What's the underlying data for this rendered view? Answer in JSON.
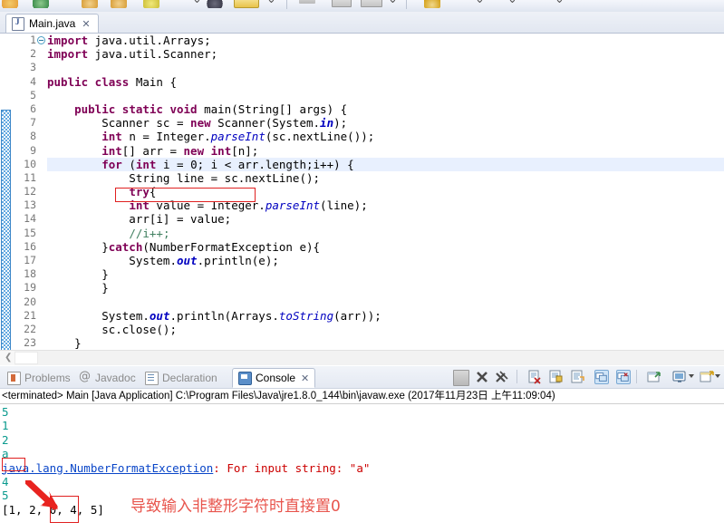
{
  "toolbar": {
    "items": [
      {
        "name": "new-wizard",
        "color": "#e8a33d"
      },
      {
        "name": "save",
        "color": "#4b8f4b"
      },
      {
        "name": "open-folder",
        "color": "#e0b050"
      },
      {
        "name": "open-type",
        "color": "#e0b050"
      },
      {
        "name": "run",
        "color": "#d9d24a"
      },
      {
        "name": "debug",
        "color": "#6a6a6a"
      },
      {
        "name": "run-last",
        "color": "#d9d24a"
      },
      {
        "name": "external-tools",
        "color": "#e8c24a"
      },
      {
        "name": "new-java-class",
        "color": "#8a8a8a"
      },
      {
        "name": "search",
        "color": "#8a8a8a"
      },
      {
        "name": "next-annotation",
        "color": "#8a8a8a"
      },
      {
        "name": "previous-annotation",
        "color": "#8a8a8a"
      },
      {
        "name": "last-edit-location",
        "color": "#d4a017"
      },
      {
        "name": "back",
        "color": "#8a8a8a"
      },
      {
        "name": "forward",
        "color": "#8a8a8a"
      }
    ]
  },
  "editor": {
    "tab_label": "Main.java",
    "close_glyph": "✕",
    "line_numbers": [
      "1",
      "2",
      "3",
      "4",
      "5",
      "6",
      "7",
      "8",
      "9",
      "10",
      "11",
      "12",
      "13",
      "14",
      "15",
      "16",
      "17",
      "18",
      "19",
      "20",
      "21",
      "22",
      "23"
    ],
    "highlighted_line": 10,
    "code_lines": [
      {
        "n": 1,
        "text": "import java.util.Arrays;"
      },
      {
        "n": 2,
        "text": "import java.util.Scanner;"
      },
      {
        "n": 3,
        "text": ""
      },
      {
        "n": 4,
        "text": "public class Main {"
      },
      {
        "n": 5,
        "text": ""
      },
      {
        "n": 6,
        "text": "    public static void main(String[] args) {"
      },
      {
        "n": 7,
        "text": "        Scanner sc = new Scanner(System.in);"
      },
      {
        "n": 8,
        "text": "        int n = Integer.parseInt(sc.nextLine());"
      },
      {
        "n": 9,
        "text": "        int[] arr = new int[n];"
      },
      {
        "n": 10,
        "text": "        for (int i = 0; i < arr.length;i++) {"
      },
      {
        "n": 11,
        "text": "            String line = sc.nextLine();"
      },
      {
        "n": 12,
        "text": "            try{"
      },
      {
        "n": 13,
        "text": "            int value = Integer.parseInt(line);"
      },
      {
        "n": 14,
        "text": "            arr[i] = value;"
      },
      {
        "n": 15,
        "text": "            //i++;"
      },
      {
        "n": 16,
        "text": "        }catch(NumberFormatException e){"
      },
      {
        "n": 17,
        "text": "            System.out.println(e);"
      },
      {
        "n": 18,
        "text": "        }"
      },
      {
        "n": 19,
        "text": "        }"
      },
      {
        "n": 20,
        "text": ""
      },
      {
        "n": 21,
        "text": "        System.out.println(Arrays.toString(arr));"
      },
      {
        "n": 22,
        "text": "        sc.close();"
      },
      {
        "n": 23,
        "text": "    }"
      }
    ]
  },
  "console": {
    "tabs": [
      {
        "label": "Problems",
        "icon": "problems-icon",
        "active": false
      },
      {
        "label": "Javadoc",
        "icon": "javadoc-icon",
        "active": false
      },
      {
        "label": "Declaration",
        "icon": "declaration-icon",
        "active": false
      },
      {
        "label": "Console",
        "icon": "console-icon",
        "active": true
      }
    ],
    "active_tab_close_glyph": "✕",
    "toolbar_icons": [
      {
        "name": "terminate-icon",
        "toggled": false
      },
      {
        "name": "remove-launch-icon",
        "toggled": false
      },
      {
        "name": "remove-all-terminated-icon",
        "toggled": false
      },
      {
        "name": "clear-console-icon",
        "toggled": false
      },
      {
        "name": "scroll-lock-icon",
        "toggled": false
      },
      {
        "name": "word-wrap-icon",
        "toggled": false
      },
      {
        "name": "show-console-on-output-icon",
        "toggled": true
      },
      {
        "name": "show-console-on-error-icon",
        "toggled": true
      },
      {
        "name": "pin-console-icon",
        "toggled": false
      },
      {
        "name": "display-selected-console-icon",
        "toggled": false
      },
      {
        "name": "display-selected-console-dropdown-icon",
        "toggled": false
      },
      {
        "name": "open-console-icon",
        "toggled": false
      },
      {
        "name": "open-console-dropdown-icon",
        "toggled": false
      }
    ],
    "header": "<terminated> Main [Java Application] C:\\Program Files\\Java\\jre1.8.0_144\\bin\\javaw.exe (2017年11月23日 上午11:09:04)",
    "output_lines": [
      {
        "text": "5",
        "stream": "stdin"
      },
      {
        "text": "1",
        "stream": "stdin"
      },
      {
        "text": "2",
        "stream": "stdin"
      },
      {
        "text": "a",
        "stream": "stdin"
      },
      {
        "text": "java.lang.NumberFormatException: For input string: \"a\"",
        "stream": "stderr",
        "link_part": "java.lang.NumberFormatException"
      },
      {
        "text": "4",
        "stream": "stdin"
      },
      {
        "text": "5",
        "stream": "stdin"
      },
      {
        "text": "[1, 2, 0, 4, 5]",
        "stream": "stdout"
      }
    ]
  },
  "annotations": {
    "note_text": "导致输入非整形字符时直接置0",
    "note_color": "#e8554d",
    "box_color": "#e02020",
    "arrow_color": "#e8231f",
    "boxed_code_fragment": "(int i = 0; i < arr.length;i++) {",
    "boxed_console_input": "a",
    "boxed_console_value": "0,"
  }
}
